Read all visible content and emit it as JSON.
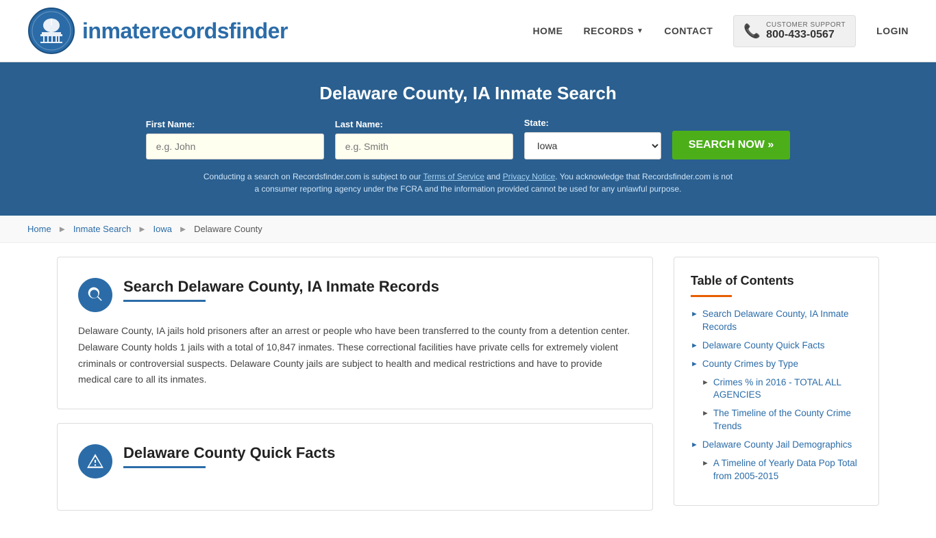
{
  "header": {
    "logo_text_normal": "inmaterecords",
    "logo_text_bold": "finder",
    "nav": {
      "home": "HOME",
      "records": "RECORDS",
      "contact": "CONTACT",
      "login": "LOGIN"
    },
    "support": {
      "label": "CUSTOMER SUPPORT",
      "number": "800-433-0567"
    }
  },
  "search_banner": {
    "title": "Delaware County, IA Inmate Search",
    "first_name_label": "First Name:",
    "first_name_placeholder": "e.g. John",
    "last_name_label": "Last Name:",
    "last_name_placeholder": "e.g. Smith",
    "state_label": "State:",
    "state_value": "Iowa",
    "search_button": "SEARCH NOW »",
    "disclaimer": "Conducting a search on Recordsfinder.com is subject to our Terms of Service and Privacy Notice. You acknowledge that Recordsfinder.com is not a consumer reporting agency under the FCRA and the information provided cannot be used for any unlawful purpose."
  },
  "breadcrumb": {
    "home": "Home",
    "inmate_search": "Inmate Search",
    "iowa": "Iowa",
    "current": "Delaware County"
  },
  "main_section": {
    "title": "Search Delaware County, IA Inmate Records",
    "body": "Delaware County, IA jails hold prisoners after an arrest or people who have been transferred to the county from a detention center. Delaware County holds 1 jails with a total of 10,847 inmates. These correctional facilities have private cells for extremely violent criminals or controversial suspects. Delaware County jails are subject to health and medical restrictions and have to provide medical care to all its inmates."
  },
  "quick_facts_section": {
    "title": "Delaware County Quick Facts"
  },
  "toc": {
    "title": "Table of Contents",
    "items": [
      {
        "label": "Search Delaware County, IA Inmate Records",
        "sub": false
      },
      {
        "label": "Delaware County Quick Facts",
        "sub": false
      },
      {
        "label": "County Crimes by Type",
        "sub": false
      },
      {
        "label": "Crimes % in 2016 - TOTAL ALL AGENCIES",
        "sub": true
      },
      {
        "label": "The Timeline of the County Crime Trends",
        "sub": true
      },
      {
        "label": "Delaware County Jail Demographics",
        "sub": false
      },
      {
        "label": "A Timeline of Yearly Data Pop Total from 2005-2015",
        "sub": true
      }
    ]
  }
}
